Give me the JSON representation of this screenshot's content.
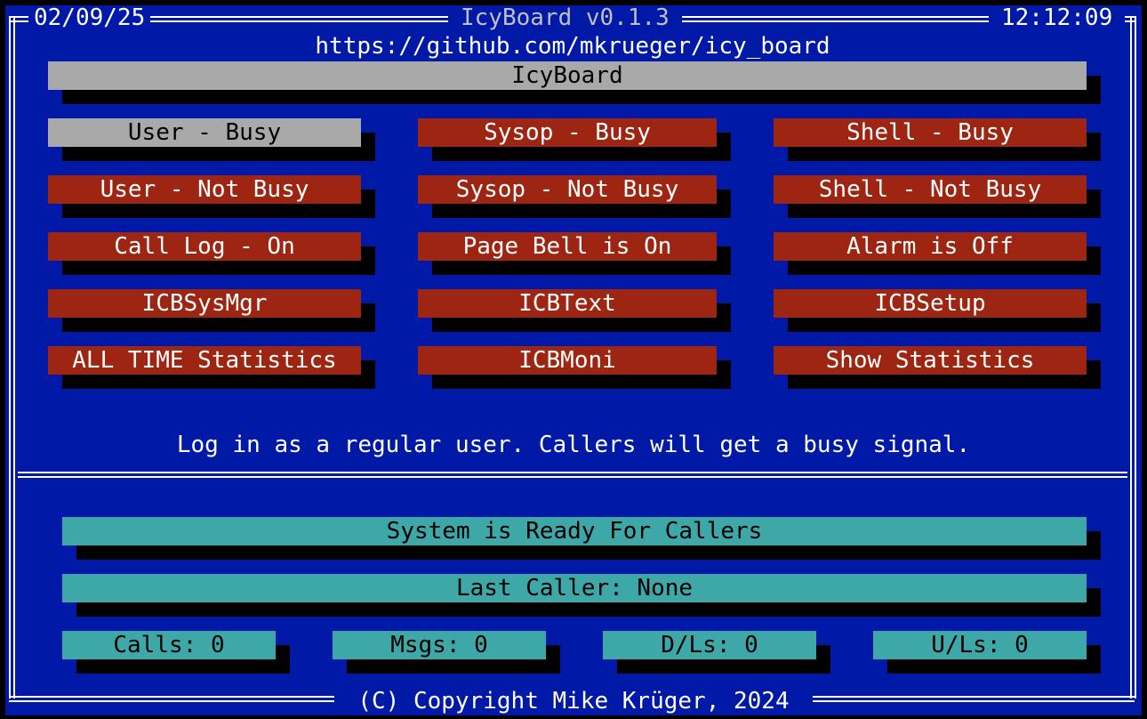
{
  "header": {
    "date": "02/09/25",
    "app_title": "IcyBoard v0.1.3",
    "time": "12:12:09",
    "url": "https://github.com/mkrueger/icy_board"
  },
  "title_bar": "IcyBoard",
  "buttons": {
    "user_busy": "User - Busy",
    "sysop_busy": "Sysop - Busy",
    "shell_busy": "Shell - Busy",
    "user_not_busy": "User - Not Busy",
    "sysop_not_busy": "Sysop - Not Busy",
    "shell_not_busy": "Shell - Not Busy",
    "call_log": "Call Log - On",
    "page_bell": "Page Bell is On",
    "alarm": "Alarm is Off",
    "icbsysmgr": "ICBSysMgr",
    "icbtext": "ICBText",
    "icbsetup": "ICBSetup",
    "all_time_stats": "ALL TIME Statistics",
    "icbmoni": "ICBMoni",
    "show_stats": "Show Statistics"
  },
  "help_text": "Log in as a regular user. Callers will get a busy signal.",
  "status": {
    "system": "System is Ready For Callers",
    "last_caller": "Last Caller: None",
    "calls": "Calls: 0",
    "msgs": "Msgs: 0",
    "dls": "D/Ls: 0",
    "uls": "U/Ls: 0"
  },
  "footer": "(C) Copyright Mike Krüger, 2024",
  "colors": {
    "background": "#0019a6",
    "button": "#9e2511",
    "selected": "#a9a9a9",
    "status_bar": "#3ea7a7"
  }
}
